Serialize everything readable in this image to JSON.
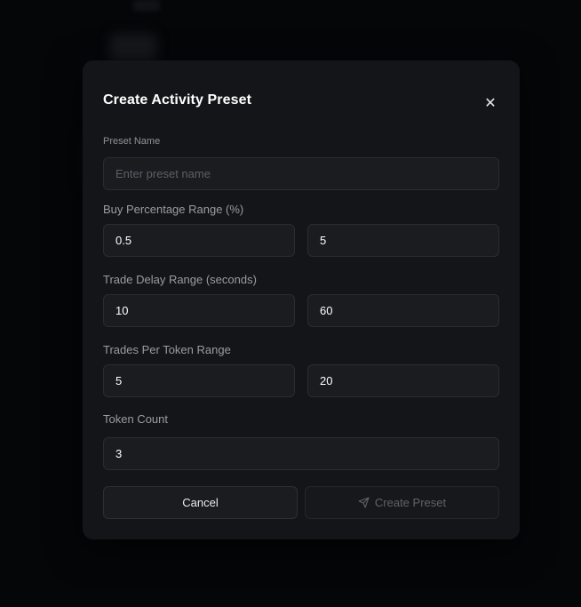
{
  "dialog": {
    "title": "Create Activity Preset",
    "close_glyph": "✕"
  },
  "preset_name": {
    "label": "Preset Name",
    "placeholder": "Enter preset name",
    "value": ""
  },
  "buy_percentage": {
    "label": "Buy Percentage Range (%)",
    "min": "0.5",
    "max": "5"
  },
  "trade_delay": {
    "label": "Trade Delay Range (seconds)",
    "min": "10",
    "max": "60"
  },
  "trades_per_token": {
    "label": "Trades Per Token Range",
    "min": "5",
    "max": "20"
  },
  "token_count": {
    "label": "Token Count",
    "value": "3"
  },
  "actions": {
    "cancel_label": "Cancel",
    "create_label": "Create Preset",
    "create_icon": "send-icon",
    "create_disabled": true
  }
}
